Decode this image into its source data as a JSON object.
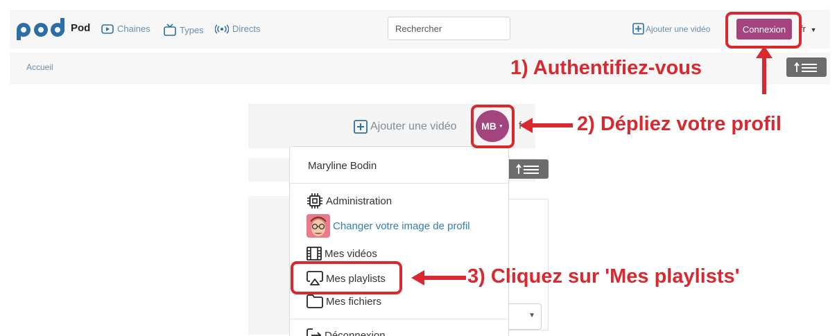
{
  "brand": {
    "name": "Pod"
  },
  "navbar": {
    "links": [
      {
        "label": "Chaines",
        "icon": "play-box-icon"
      },
      {
        "label": "Types",
        "icon": "tv-icon"
      },
      {
        "label": "Directs",
        "icon": "broadcast-icon"
      }
    ],
    "search_placeholder": "Rechercher",
    "add_video": "Ajouter une vidéo",
    "login": "Connexion",
    "lang": "fr"
  },
  "breadcrumb": {
    "home": "Accueil"
  },
  "profile_view": {
    "add_video": "Ajouter une vidéo",
    "avatar_initials": "MB",
    "lang_partial": "f"
  },
  "dropdown": {
    "user_name": "Maryline Bodin",
    "items": [
      {
        "label": "Administration",
        "icon": "chip-icon"
      },
      {
        "label": "Changer votre image de profil",
        "icon": "avatar-face-icon"
      },
      {
        "label": "Mes vidéos",
        "icon": "film-icon"
      },
      {
        "label": "Mes playlists",
        "icon": "airplay-icon"
      },
      {
        "label": "Mes fichiers",
        "icon": "folder-icon"
      },
      {
        "label": "Déconnexion",
        "icon": "logout-icon"
      }
    ]
  },
  "annotations": {
    "step1": "1) Authentifiez-vous",
    "step2": "2) Dépliez votre profil",
    "step3": "3) Cliquez sur 'Mes playlists'"
  },
  "colors": {
    "brand_blue": "#2c6fa8",
    "accent_purple": "#a3447e",
    "annotation_red": "#d9292f",
    "link_blue": "#2f7fb4"
  }
}
